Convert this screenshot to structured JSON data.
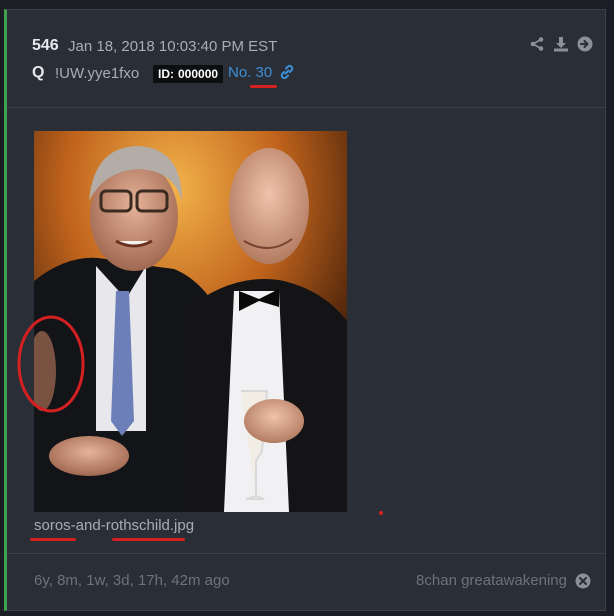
{
  "post": {
    "number": "546",
    "date": "Jan 18, 2018 10:03:40 PM EST",
    "author": "Q",
    "tripcode": "!UW.yye1fxo",
    "id_label": "ID:",
    "id_value": "000000",
    "no_label": "No.",
    "no_value": "30"
  },
  "image": {
    "filename": "soros-and-rothschild.jpg"
  },
  "footer": {
    "ago": "6y, 8m, 1w, 3d, 17h, 42m ago",
    "board": "8chan greatawakening"
  },
  "icons": {
    "share": "share-icon",
    "download": "download-icon",
    "goto": "arrow-circle-right-icon",
    "link": "link-icon",
    "close": "close-circle-icon"
  },
  "colors": {
    "accent_bar": "#3fa34d",
    "link": "#3d8fd6",
    "annotation": "#d42020"
  }
}
